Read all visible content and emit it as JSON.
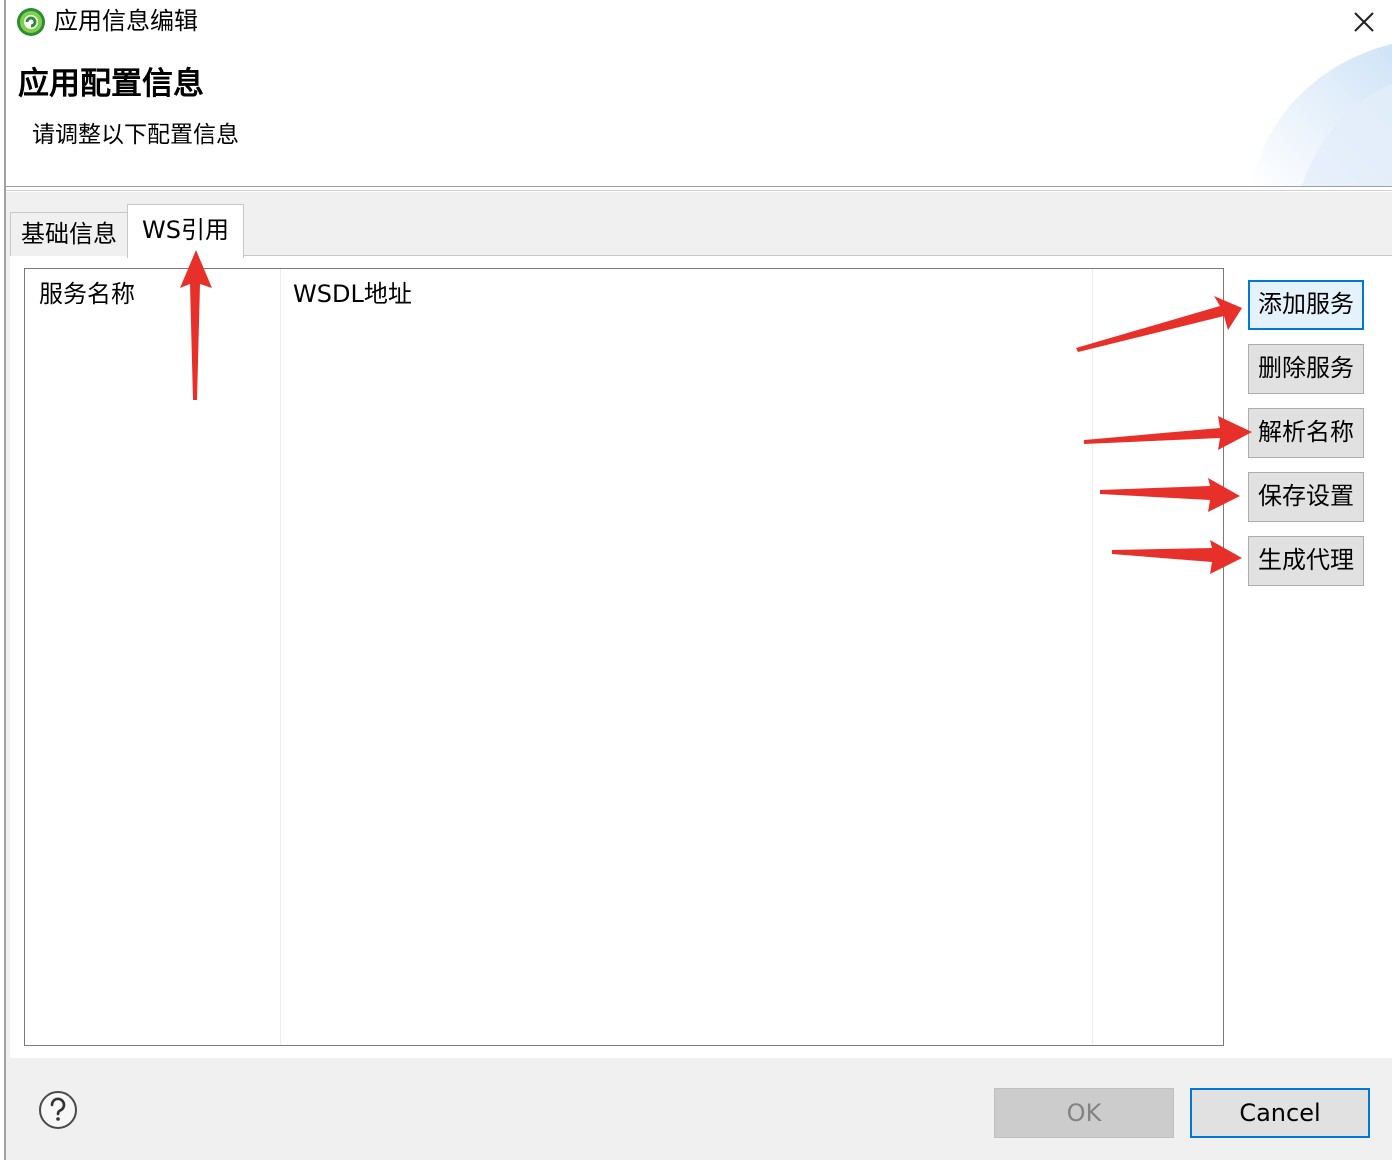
{
  "window": {
    "title": "应用信息编辑",
    "app_icon": "app-logo-icon",
    "close_icon": "close-icon"
  },
  "header": {
    "title": "应用配置信息",
    "subtitle": "请调整以下配置信息"
  },
  "tabs": [
    {
      "label": "基础信息",
      "selected": false
    },
    {
      "label": "WS引用",
      "selected": true
    }
  ],
  "table": {
    "columns": [
      "服务名称",
      "WSDL地址"
    ],
    "rows": []
  },
  "side_buttons": [
    {
      "label": "添加服务",
      "focused": true
    },
    {
      "label": "删除服务",
      "focused": false
    },
    {
      "label": "解析名称",
      "focused": false
    },
    {
      "label": "保存设置",
      "focused": false
    },
    {
      "label": "生成代理",
      "focused": false
    }
  ],
  "footer": {
    "help_icon": "help-icon",
    "ok_label": "OK",
    "ok_enabled": false,
    "cancel_label": "Cancel"
  },
  "colors": {
    "accent": "#0078d7",
    "annotation_arrow": "#e8302a",
    "dialog_bg": "#f0f0f0"
  }
}
